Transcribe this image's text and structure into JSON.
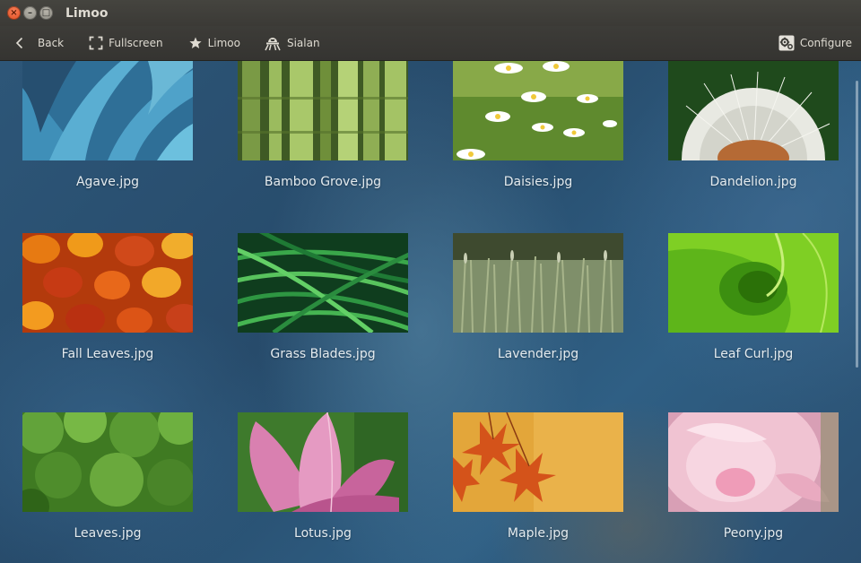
{
  "window": {
    "title": "Limoo"
  },
  "toolbar": {
    "back_label": "Back",
    "fullscreen_label": "Fullscreen",
    "limoo_label": "Limoo",
    "sialan_label": "Sialan",
    "configure_label": "Configure"
  },
  "gallery": {
    "items": [
      {
        "name": "Agave.jpg"
      },
      {
        "name": "Bamboo Grove.jpg"
      },
      {
        "name": "Daisies.jpg"
      },
      {
        "name": "Dandelion.jpg"
      },
      {
        "name": "Fall Leaves.jpg"
      },
      {
        "name": "Grass Blades.jpg"
      },
      {
        "name": "Lavender.jpg"
      },
      {
        "name": "Leaf Curl.jpg"
      },
      {
        "name": "Leaves.jpg"
      },
      {
        "name": "Lotus.jpg"
      },
      {
        "name": "Maple.jpg"
      },
      {
        "name": "Peony.jpg"
      }
    ]
  },
  "icons": {
    "back": "chevron-left-icon",
    "fullscreen": "fullscreen-icon",
    "limoo": "star-icon",
    "sialan": "sialan-icon",
    "configure": "gear-icon"
  },
  "colors": {
    "titlebar": "#3b3a36",
    "toolbar": "#3a3935",
    "close_button": "#df4a1c",
    "text": "#dfdbd2"
  }
}
